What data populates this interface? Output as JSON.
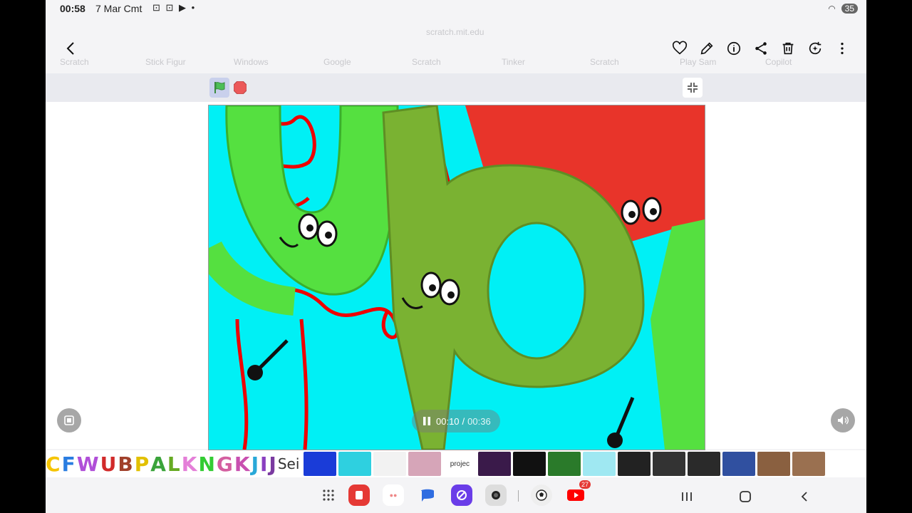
{
  "status": {
    "time": "00:58",
    "date": "7 Mar Cmt",
    "icons": "⊡ ⊡ ▶ •",
    "battery": "35"
  },
  "browser_ghost": {
    "url": "scratch.mit.edu",
    "tabs": [
      "Scratch",
      "Stick Figur",
      "Windows",
      "Google",
      "Scratch",
      "Tinker",
      "Scratch",
      "Play Sam",
      "Copilot"
    ]
  },
  "icons": {
    "back": "back-arrow-icon",
    "favorite": "heart-icon",
    "edit": "pencil-icon",
    "info": "info-icon",
    "share": "share-icon",
    "delete": "trash-icon",
    "remaster": "remaster-icon",
    "more": "more-vertical-icon"
  },
  "scratch": {
    "green_flag_color": "#4cbf56",
    "stop_color": "#ec5959",
    "stage_bg": "#00f0f5"
  },
  "player": {
    "current": "00:10",
    "separator": "/",
    "total": "00:36",
    "progress": 0.278
  },
  "filmstrip": {
    "letters": [
      "C",
      "F",
      "W",
      "U",
      "B",
      "P",
      "A",
      "L",
      "K",
      "N",
      "G",
      "K",
      "J",
      "I",
      "J",
      "Sei"
    ],
    "thumbs_label": "projec",
    "thumb_count": 15
  },
  "dock": {
    "youtube_badge": "27"
  }
}
